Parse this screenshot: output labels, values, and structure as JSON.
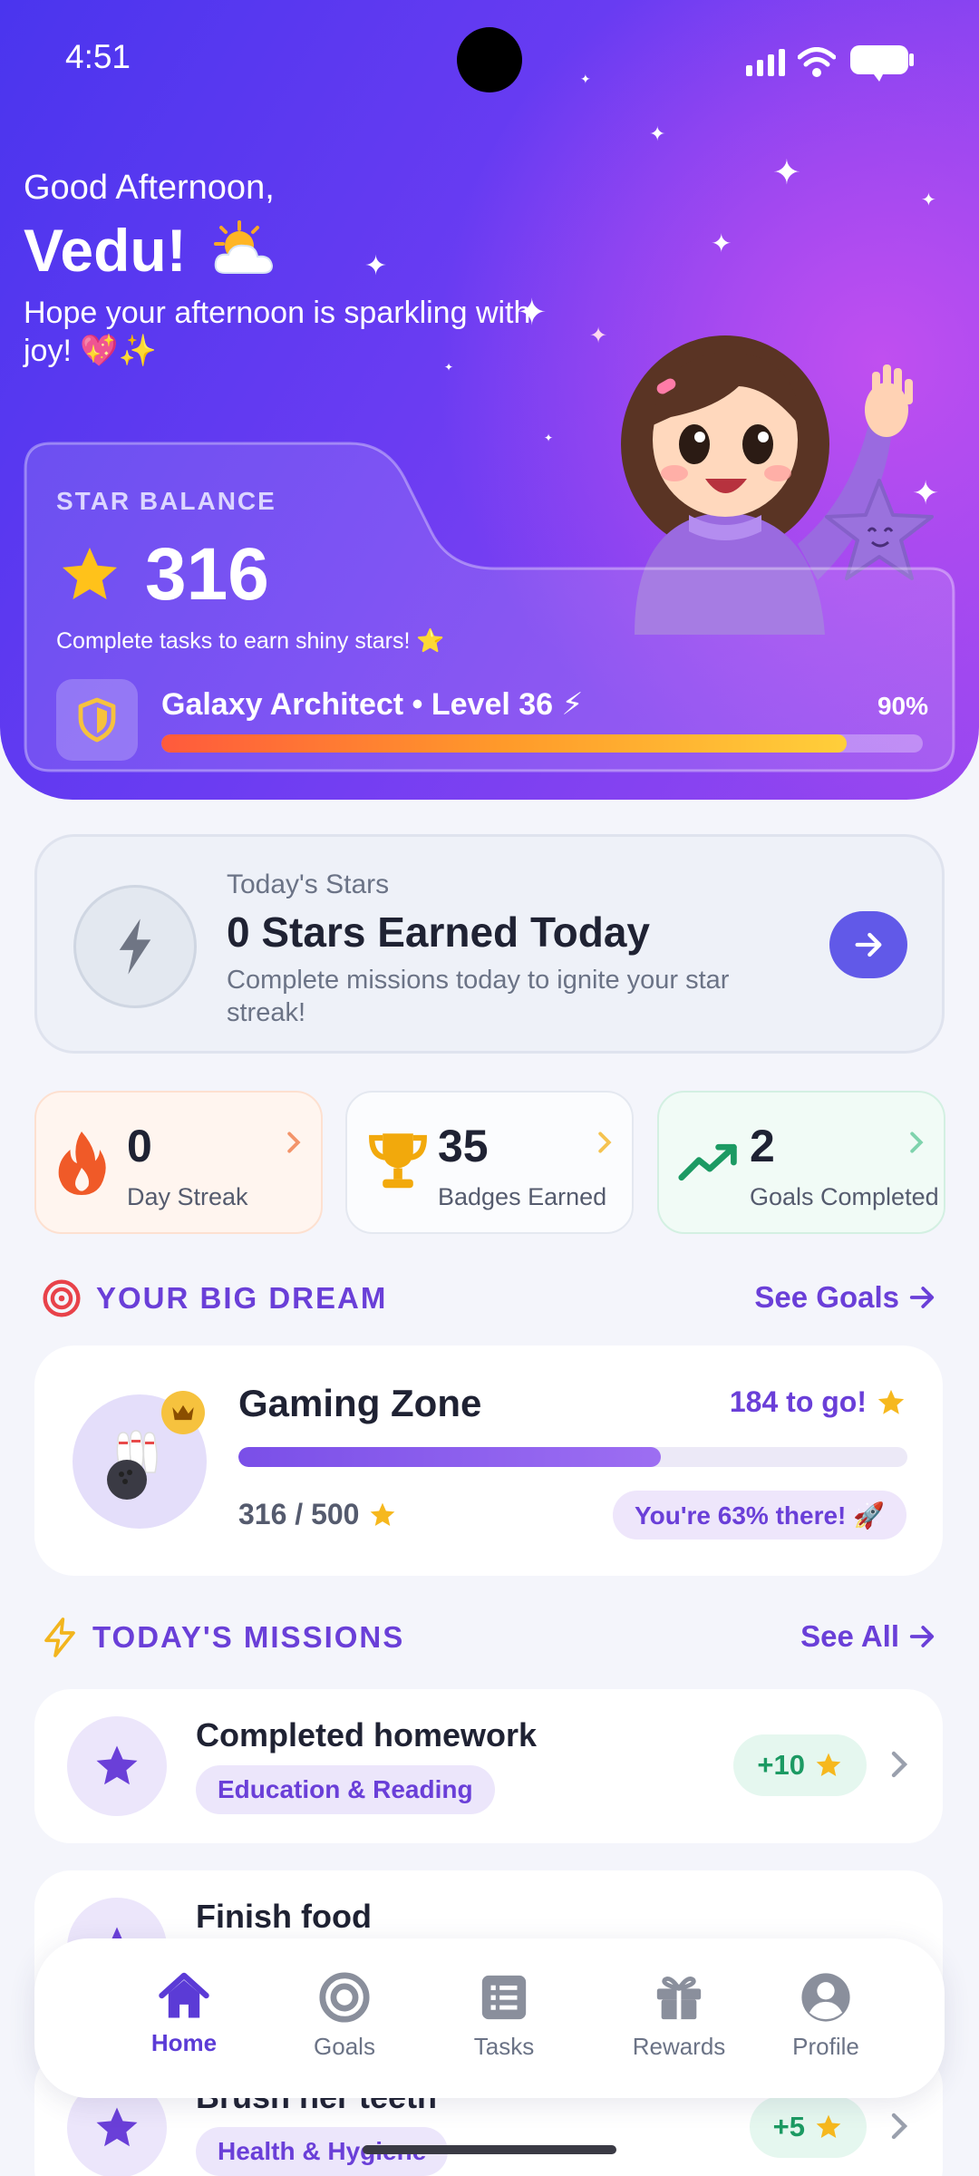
{
  "status_bar": {
    "time": "4:51"
  },
  "hero": {
    "greeting": "Good Afternoon,",
    "name": "Vedu!",
    "name_emoji": "🌤️",
    "subtitle": "Hope your afternoon is sparkling with joy! 💖✨",
    "balance_label": "STAR BALANCE",
    "balance_value": "316",
    "balance_hint": "Complete tasks to earn shiny stars! ⭐",
    "level_text": "Galaxy Architect • Level 36 ⚡",
    "level_percent_text": "90%",
    "level_progress": 0.9
  },
  "today": {
    "label": "Today's Stars",
    "title": "0 Stars Earned Today",
    "description": "Complete missions today to ignite your star streak!"
  },
  "stats": [
    {
      "value": "0",
      "label": "Day Streak",
      "icon": "flame-icon",
      "color": "#f05a28"
    },
    {
      "value": "35",
      "label": "Badges Earned",
      "icon": "trophy-icon",
      "color": "#f2a90c"
    },
    {
      "value": "2",
      "label": "Goals Completed",
      "icon": "trending-up-icon",
      "color": "#1c9a63"
    }
  ],
  "dream_section": {
    "title": "YOUR BIG DREAM",
    "link": "See Goals"
  },
  "dream": {
    "name": "Gaming Zone",
    "to_go": "184 to go!",
    "progress_text": "316 / 500",
    "progress": 0.632,
    "pill": "You're 63% there! 🚀"
  },
  "missions_section": {
    "title": "TODAY'S MISSIONS",
    "link": "See All"
  },
  "missions": [
    {
      "title": "Completed homework",
      "tag": "Education & Reading",
      "points": "+10"
    },
    {
      "title": "Finish food",
      "tag": "",
      "points": ""
    },
    {
      "title": "Brush her teeth",
      "tag": "Health & Hygiene",
      "points": "+5"
    }
  ],
  "nav": [
    {
      "label": "Home",
      "icon": "home-icon",
      "active": true
    },
    {
      "label": "Goals",
      "icon": "target-icon",
      "active": false
    },
    {
      "label": "Tasks",
      "icon": "list-icon",
      "active": false
    },
    {
      "label": "Rewards",
      "icon": "gift-icon",
      "active": false
    },
    {
      "label": "Profile",
      "icon": "user-icon",
      "active": false
    }
  ],
  "colors": {
    "accent": "#6a3fd8",
    "hero_start": "#4a35ee",
    "hero_end": "#9a47f0",
    "star": "#f6b81e"
  }
}
